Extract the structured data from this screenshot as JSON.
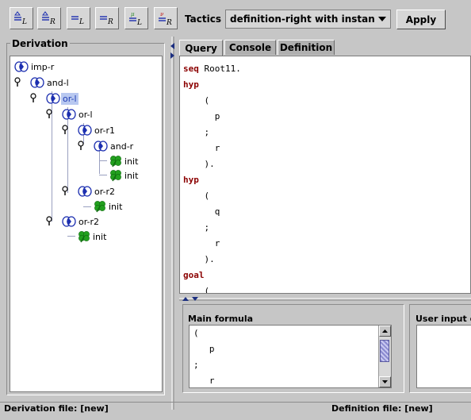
{
  "toolbar": {
    "buttons": [
      {
        "name": "assume-left-button",
        "sym_top": "≙",
        "sym_sub": "L"
      },
      {
        "name": "assume-right-button",
        "sym_top": "≙",
        "sym_sub": "R"
      },
      {
        "name": "equal-left-button",
        "sym_top": "=",
        "sym_sub": "L"
      },
      {
        "name": "equal-right-button",
        "sym_top": "=",
        "sym_sub": "R"
      },
      {
        "name": "mu-left-button",
        "sym_top": "μ",
        "sym_sub": "L"
      },
      {
        "name": "nu-right-button",
        "sym_top": "ν",
        "sym_sub": "R"
      }
    ],
    "tactics_label": "Tactics",
    "tactics_selected": "definition-right with instantiation",
    "apply_label": "Apply"
  },
  "derivation": {
    "title": "Derivation",
    "nodes": [
      {
        "label": "imp-r",
        "icon": "sequent-icon"
      },
      {
        "label": "and-l",
        "icon": "sequent-icon"
      },
      {
        "label": "or-l",
        "icon": "sequent-icon",
        "selected": true
      },
      {
        "label": "or-l",
        "icon": "sequent-icon"
      },
      {
        "label": "or-r1",
        "icon": "sequent-icon"
      },
      {
        "label": "and-r",
        "icon": "sequent-icon"
      },
      {
        "label": "init",
        "icon": "clover-icon"
      },
      {
        "label": "init",
        "icon": "clover-icon"
      },
      {
        "label": "or-r2",
        "icon": "sequent-icon"
      },
      {
        "label": "init",
        "icon": "clover-icon"
      },
      {
        "label": "or-r2",
        "icon": "sequent-icon"
      },
      {
        "label": "init",
        "icon": "clover-icon"
      }
    ]
  },
  "tabs": [
    {
      "label": "Query",
      "active": true
    },
    {
      "label": "Console",
      "active": false
    },
    {
      "label": "Definition",
      "active": false
    }
  ],
  "query": {
    "lines": [
      {
        "kw": "seq",
        "text": " Root11."
      },
      {
        "kw": "hyp",
        "text": ""
      },
      {
        "kw": "",
        "text": "    ("
      },
      {
        "kw": "",
        "text": "      p"
      },
      {
        "kw": "",
        "text": "    ;"
      },
      {
        "kw": "",
        "text": "      r"
      },
      {
        "kw": "",
        "text": "    )."
      },
      {
        "kw": "hyp",
        "text": ""
      },
      {
        "kw": "",
        "text": "    ("
      },
      {
        "kw": "",
        "text": "      q"
      },
      {
        "kw": "",
        "text": "    ;"
      },
      {
        "kw": "",
        "text": "      r"
      },
      {
        "kw": "",
        "text": "    )."
      },
      {
        "kw": "goal",
        "text": ""
      },
      {
        "kw": "",
        "text": "    ("
      }
    ]
  },
  "main_formula": {
    "title": "Main formula",
    "lines": [
      "(",
      "   p",
      ";",
      "   r"
    ]
  },
  "user_input": {
    "title": "User input ex"
  },
  "status": {
    "derivation_file": "Derivation file: [new]",
    "definition_file": "Definition file: [new]"
  },
  "colors": {
    "keyword": "#8b0000",
    "selection": "#b8c8f0",
    "background": "#c6c6c6"
  }
}
